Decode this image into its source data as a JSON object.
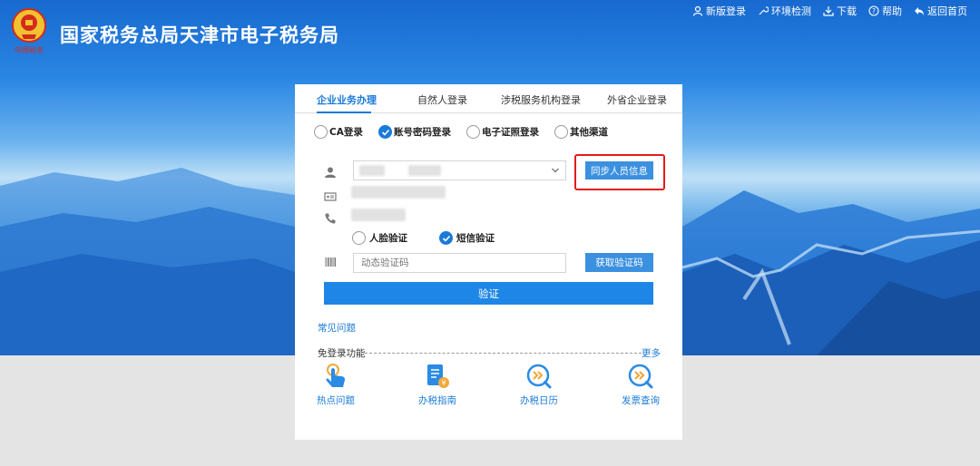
{
  "header": {
    "site_title": "国家税务总局天津市电子税务局",
    "logo_subtitle": "中国税务",
    "nav": [
      {
        "label": "新版登录",
        "icon": "user-icon"
      },
      {
        "label": "环境检测",
        "icon": "wrench-icon"
      },
      {
        "label": "下载",
        "icon": "download-icon"
      },
      {
        "label": "帮助",
        "icon": "help-icon"
      },
      {
        "label": "返回首页",
        "icon": "back-arrow-icon"
      }
    ]
  },
  "tabs": [
    {
      "label": "企业业务办理",
      "active": true
    },
    {
      "label": "自然人登录",
      "active": false
    },
    {
      "label": "涉税服务机构登录",
      "active": false
    },
    {
      "label": "外省企业登录",
      "active": false
    }
  ],
  "login_methods": [
    {
      "label": "CA登录",
      "checked": false
    },
    {
      "label": "账号密码登录",
      "checked": true
    },
    {
      "label": "电子证照登录",
      "checked": false
    },
    {
      "label": "其他渠道",
      "checked": false
    }
  ],
  "form": {
    "sync_button": "同步人员信息",
    "verify_methods": [
      {
        "label": "人脸验证",
        "checked": false
      },
      {
        "label": "短信验证",
        "checked": true
      }
    ],
    "code_placeholder": "动态验证码",
    "get_code_button": "获取验证码",
    "submit_button": "验证"
  },
  "links": {
    "faq": "常见问题",
    "free_login": "免登录功能",
    "more": "更多"
  },
  "quick_links": [
    {
      "label": "热点问题",
      "icon": "tap-hand-icon"
    },
    {
      "label": "办税指南",
      "icon": "guide-book-icon"
    },
    {
      "label": "办税日历",
      "icon": "calendar-chevron-icon"
    },
    {
      "label": "发票查询",
      "icon": "invoice-search-icon"
    }
  ],
  "colors": {
    "accent": "#1a7ad9",
    "button": "#3b90e0",
    "highlight_border": "#e51b1b"
  }
}
